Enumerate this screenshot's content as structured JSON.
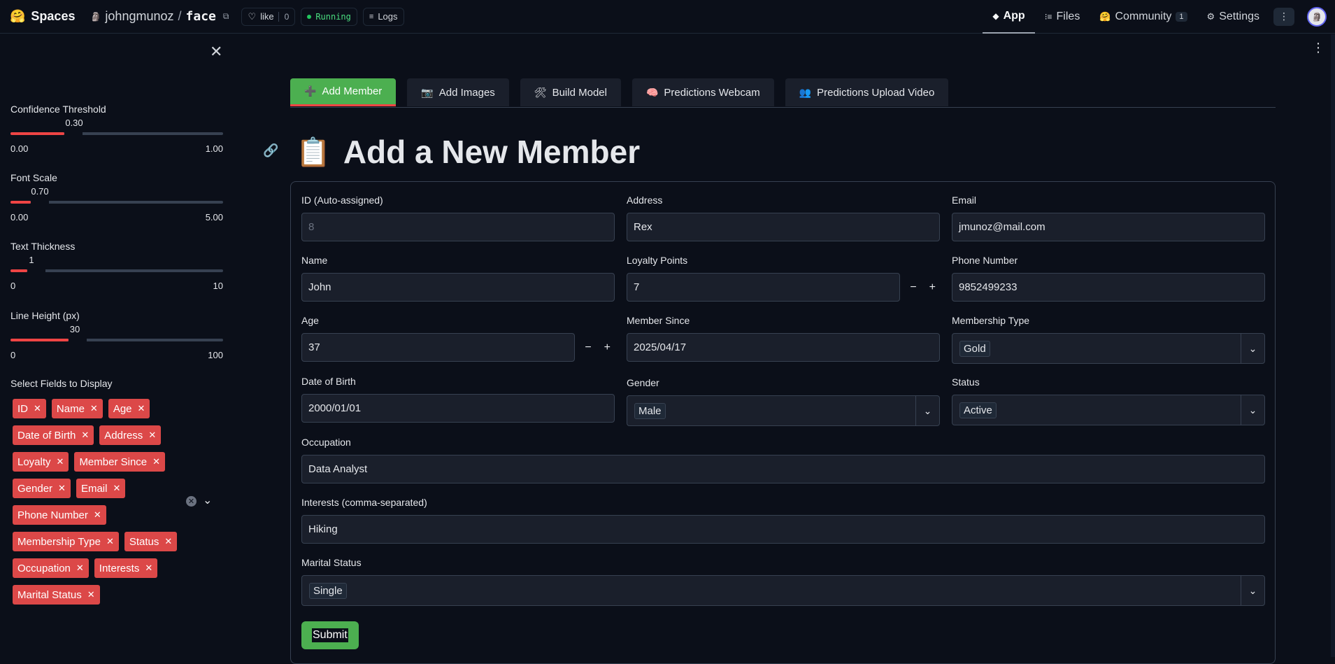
{
  "topbar": {
    "brand": "Spaces",
    "owner": "johngmunoz",
    "space": "face",
    "like_label": "like",
    "like_count": "0",
    "status": "Running",
    "logs": "Logs",
    "nav": [
      {
        "label": "App",
        "icon": "cube-icon",
        "active": true
      },
      {
        "label": "Files",
        "icon": "files-icon",
        "active": false
      },
      {
        "label": "Community",
        "icon": "community-icon",
        "badge": "1",
        "active": false
      },
      {
        "label": "Settings",
        "icon": "gear-icon",
        "active": false
      }
    ]
  },
  "sidebar": {
    "sliders": [
      {
        "label": "Confidence Threshold",
        "value": "0.30",
        "min": "0.00",
        "max": "1.00",
        "fraction": 0.3
      },
      {
        "label": "Font Scale",
        "value": "0.70",
        "min": "0.00",
        "max": "5.00",
        "fraction": 0.14
      },
      {
        "label": "Text Thickness",
        "value": "1",
        "min": "0",
        "max": "10",
        "fraction": 0.1
      },
      {
        "label": "Line Height (px)",
        "value": "30",
        "min": "0",
        "max": "100",
        "fraction": 0.3
      }
    ],
    "fields_label": "Select Fields to Display",
    "fields": [
      "ID",
      "Name",
      "Age",
      "Date of Birth",
      "Address",
      "Loyalty",
      "Member Since",
      "Gender",
      "Email",
      "Phone Number",
      "Membership Type",
      "Status",
      "Occupation",
      "Interests",
      "Marital Status"
    ]
  },
  "tabs": [
    {
      "label": "Add Member",
      "icon": "➕",
      "active": true
    },
    {
      "label": "Add Images",
      "icon": "📷",
      "active": false
    },
    {
      "label": "Build Model",
      "icon": "🛠",
      "active": false
    },
    {
      "label": "Predictions Webcam",
      "icon": "🧠",
      "active": false
    },
    {
      "label": "Predictions Upload Video",
      "icon": "👥",
      "active": false
    }
  ],
  "page": {
    "title_icon": "📋",
    "title": "Add a New Member"
  },
  "form": {
    "id_label": "ID (Auto-assigned)",
    "id_placeholder": "8",
    "address_label": "Address",
    "address_value": "Rex",
    "email_label": "Email",
    "email_value": "jmunoz@mail.com",
    "name_label": "Name",
    "name_value": "John",
    "loyalty_label": "Loyalty Points",
    "loyalty_value": "7",
    "phone_label": "Phone Number",
    "phone_value": "9852499233",
    "age_label": "Age",
    "age_value": "37",
    "member_since_label": "Member Since",
    "member_since_value": "2025/04/17",
    "membership_label": "Membership Type",
    "membership_value": "Gold",
    "dob_label": "Date of Birth",
    "dob_value": "2000/01/01",
    "gender_label": "Gender",
    "gender_value": "Male",
    "status_label": "Status",
    "status_value": "Active",
    "occupation_label": "Occupation",
    "occupation_value": "Data Analyst",
    "interests_label": "Interests (comma-separated)",
    "interests_value": "Hiking",
    "marital_label": "Marital Status",
    "marital_value": "Single",
    "submit_label": "Submit"
  },
  "colors": {
    "accent_green": "#4caf50",
    "accent_red": "#dc4848",
    "background": "#0b0f19"
  }
}
